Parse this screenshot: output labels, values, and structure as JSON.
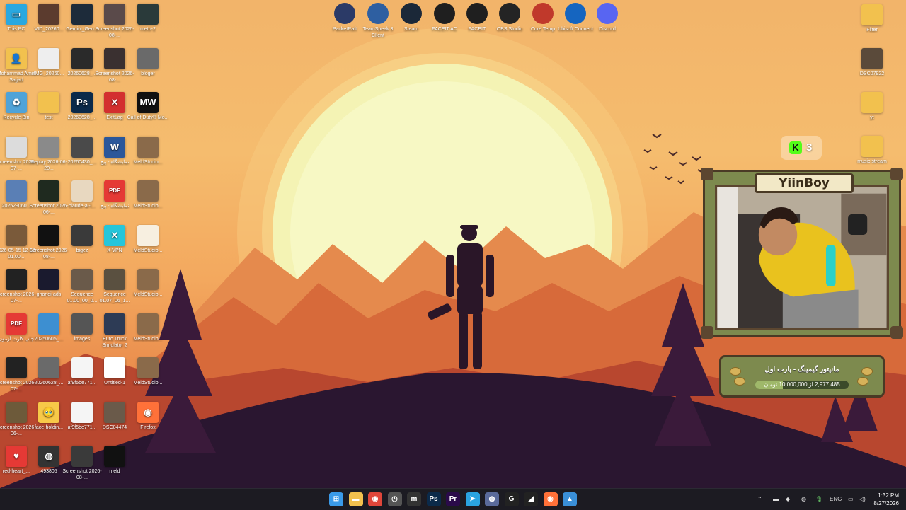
{
  "desktop": {
    "top_icons": [
      {
        "label": "PacketRaft",
        "icon": "packetraft-icon",
        "color": "#2b3a67"
      },
      {
        "label": "TeamSpeak 3 Client",
        "icon": "teamspeak-icon",
        "color": "#2e5fa1"
      },
      {
        "label": "Steam",
        "icon": "steam-icon",
        "color": "#1b2838"
      },
      {
        "label": "FACEIT AC",
        "icon": "faceit-ac-icon",
        "color": "#1f1f1f"
      },
      {
        "label": "FACEIT",
        "icon": "faceit-icon",
        "color": "#1f1f1f"
      },
      {
        "label": "OBS Studio",
        "icon": "obs-icon",
        "color": "#242424"
      },
      {
        "label": "Core Temp",
        "icon": "thermometer-icon",
        "color": "#c0392b"
      },
      {
        "label": "Ubisoft Connect",
        "icon": "ubisoft-icon",
        "color": "#1565c0"
      },
      {
        "label": "Discord",
        "icon": "discord-icon",
        "color": "#5865f2"
      }
    ],
    "columns": [
      [
        {
          "label": "This PC",
          "icon": "monitor-icon",
          "color": "#29a8e0",
          "glyph": "▭"
        },
        {
          "label": "Mohammad Amin Sajjad",
          "icon": "user-folder-icon",
          "color": "#f2c14e",
          "glyph": "👤"
        },
        {
          "label": "Recycle Bin",
          "icon": "recycle-bin-icon",
          "color": "#4fa3d8",
          "glyph": "♻"
        },
        {
          "label": "Screenshot 2026-07-...",
          "icon": "screenshot-icon",
          "color": "#dcdcdc",
          "glyph": ""
        },
        {
          "label": "202529060...",
          "icon": "photo-icon",
          "color": "#5a7fb5",
          "glyph": ""
        },
        {
          "label": "2026-05-15 12-17-01.00...",
          "icon": "video-icon",
          "color": "#7a5a3a",
          "glyph": ""
        },
        {
          "label": "Screenshot 2026-07-...",
          "icon": "screenshot-icon",
          "color": "#222",
          "glyph": ""
        },
        {
          "label": "چاپ کارت آزمون",
          "icon": "pdf-icon",
          "color": "#e53935",
          "glyph": "PDF"
        },
        {
          "label": "Screenshot 2026-07-...",
          "icon": "screenshot-icon",
          "color": "#222",
          "glyph": ""
        },
        {
          "label": "Screenshot 2026-06-...",
          "icon": "screenshot-icon",
          "color": "#6d5a3a",
          "glyph": ""
        },
        {
          "label": "red-heart_...",
          "icon": "heart-icon",
          "color": "#e53935",
          "glyph": "♥"
        }
      ],
      [
        {
          "label": "VID_20260...",
          "icon": "video-icon",
          "color": "#5b3b2e",
          "glyph": ""
        },
        {
          "label": "IMG_20260...",
          "icon": "image-icon",
          "color": "#eee",
          "glyph": ""
        },
        {
          "label": "test",
          "icon": "folder-icon",
          "color": "#f2c14e",
          "glyph": ""
        },
        {
          "label": "Replay 2026-06-20...",
          "icon": "video-icon",
          "color": "#8a8a8a",
          "glyph": ""
        },
        {
          "label": "Screenshot 2026-06-...",
          "icon": "screenshot-icon",
          "color": "#1f2a1f",
          "glyph": ""
        },
        {
          "label": "Screenshot 2026-08-...",
          "icon": "screenshot-icon",
          "color": "#111",
          "glyph": ""
        },
        {
          "label": "ghandi-ads",
          "icon": "video-icon",
          "color": "#1a1a2e",
          "glyph": ""
        },
        {
          "label": "20250605_...",
          "icon": "photo-icon",
          "color": "#3d8fd1",
          "glyph": ""
        },
        {
          "label": "20260628_...",
          "icon": "video-icon",
          "color": "#6a6a6a",
          "glyph": ""
        },
        {
          "label": "face-holdin...",
          "icon": "emoji-icon",
          "color": "#f7c948",
          "glyph": "🥹"
        },
        {
          "label": "493805",
          "icon": "globe-icon",
          "color": "#333",
          "glyph": "◍"
        }
      ],
      [
        {
          "label": "Gemini_Gen...",
          "icon": "image-icon",
          "color": "#1d2b3a",
          "glyph": ""
        },
        {
          "label": "20260628_...",
          "icon": "video-icon",
          "color": "#2a2a2a",
          "glyph": ""
        },
        {
          "label": "20260628_...",
          "icon": "psd-icon",
          "color": "#0b2a4a",
          "glyph": "Ps"
        },
        {
          "label": "20260430_...",
          "icon": "video-icon",
          "color": "#4a4a4a",
          "glyph": ""
        },
        {
          "label": "claude-ai-l...",
          "icon": "image-icon",
          "color": "#e8d8c0",
          "glyph": ""
        },
        {
          "label": "bigez",
          "icon": "video-icon",
          "color": "#3a3a3a",
          "glyph": ""
        },
        {
          "label": "Sequence 01.00_00_0...",
          "icon": "video-icon",
          "color": "#6a5a4a",
          "glyph": ""
        },
        {
          "label": "images",
          "icon": "image-icon",
          "color": "#555",
          "glyph": ""
        },
        {
          "label": "af9f5be771...",
          "icon": "image-icon",
          "color": "#f5f5f5",
          "glyph": ""
        },
        {
          "label": "af9f5be771...",
          "icon": "image-icon",
          "color": "#f5f5f5",
          "glyph": ""
        },
        {
          "label": "Screenshot 2026-08-...",
          "icon": "screenshot-icon",
          "color": "#3a3a3a",
          "glyph": ""
        }
      ],
      [
        {
          "label": "Screenshot 2026-08-...",
          "icon": "screenshot-icon",
          "color": "#5a4a4a",
          "glyph": ""
        },
        {
          "label": "Screenshot 2026-08-...",
          "icon": "screenshot-icon",
          "color": "#3a3030",
          "glyph": ""
        },
        {
          "label": "ExitLag",
          "icon": "exitlag-icon",
          "color": "#d32f2f",
          "glyph": "✕"
        },
        {
          "label": "نمایشگاه - پیج",
          "icon": "word-icon",
          "color": "#2b579a",
          "glyph": "W"
        },
        {
          "label": "نمایشگاه - پیج",
          "icon": "pdf-icon",
          "color": "#e53935",
          "glyph": "PDF"
        },
        {
          "label": "X-VPN",
          "icon": "xvpn-icon",
          "color": "#26c6da",
          "glyph": "✕"
        },
        {
          "label": "Sequence 01.07_06_1...",
          "icon": "video-icon",
          "color": "#5a5040",
          "glyph": ""
        },
        {
          "label": "Euro Truck Simulator 2",
          "icon": "truck-icon",
          "color": "#2d3b55",
          "glyph": ""
        },
        {
          "label": "Untitled-1",
          "icon": "image-icon",
          "color": "#ffffff",
          "glyph": ""
        },
        {
          "label": "DSC04474",
          "icon": "photo-icon",
          "color": "#6a5a4a",
          "glyph": ""
        },
        {
          "label": "meld",
          "icon": "video-icon",
          "color": "#111",
          "glyph": ""
        }
      ],
      [
        {
          "label": "meto-2",
          "icon": "screenshot-icon",
          "color": "#2a3a3a",
          "glyph": ""
        },
        {
          "label": "bloger",
          "icon": "video-icon",
          "color": "#6a6a6a",
          "glyph": ""
        },
        {
          "label": "Call of Duty® Mo...",
          "icon": "cod-icon",
          "color": "#111",
          "glyph": "MW"
        },
        {
          "label": "MeldStudio...",
          "icon": "video-icon",
          "color": "#8a6a4a",
          "glyph": ""
        },
        {
          "label": "MeldStudio...",
          "icon": "video-icon",
          "color": "#8a6a4a",
          "glyph": ""
        },
        {
          "label": "MeldStudio...",
          "icon": "file-icon",
          "color": "#f7efe0",
          "glyph": ""
        },
        {
          "label": "MeldStudio...",
          "icon": "video-icon",
          "color": "#8a6a4a",
          "glyph": ""
        },
        {
          "label": "MeldStudio...",
          "icon": "video-icon",
          "color": "#8a6a4a",
          "glyph": ""
        },
        {
          "label": "MeldStudio...",
          "icon": "video-icon",
          "color": "#8a6a4a",
          "glyph": ""
        },
        {
          "label": "Firefox",
          "icon": "firefox-icon",
          "color": "#ff7139",
          "glyph": "◉"
        }
      ]
    ],
    "right_icons": [
      {
        "label": "Filter",
        "icon": "folder-icon",
        "color": "#f2c14e"
      },
      {
        "label": "DSC07922",
        "icon": "photo-icon",
        "color": "#5a4a3a"
      },
      {
        "label": "yt",
        "icon": "folder-icon",
        "color": "#f2c14e"
      },
      {
        "label": "music stream",
        "icon": "folder-icon",
        "color": "#f2c14e"
      }
    ]
  },
  "overlay": {
    "kick_count": "3",
    "streamer_name": "YiinBoy",
    "goal_title": "مانیتور گیمینگ - پارت اول",
    "goal_text": "2,977,485 از 10,000,000 تومان",
    "goal_progress": 0.2977
  },
  "taskbar": {
    "apps": [
      {
        "icon": "windows-start-icon",
        "color": "#3a9ae8",
        "glyph": "⊞"
      },
      {
        "icon": "file-explorer-icon",
        "color": "#f2c14e",
        "glyph": "▬"
      },
      {
        "icon": "chrome-icon",
        "color": "#e0463a",
        "glyph": "◉"
      },
      {
        "icon": "clock-app-icon",
        "color": "#555",
        "glyph": "◷"
      },
      {
        "icon": "meld-icon",
        "color": "#333",
        "glyph": "m",
        "active": true
      },
      {
        "icon": "photoshop-icon",
        "color": "#0b2a4a",
        "glyph": "Ps"
      },
      {
        "icon": "premiere-icon",
        "color": "#2a0a4a",
        "glyph": "Pr"
      },
      {
        "icon": "telegram-icon",
        "color": "#2aa3df",
        "glyph": "➤"
      },
      {
        "icon": "app-icon",
        "color": "#5a6a9a",
        "glyph": "◍"
      },
      {
        "icon": "cursor-app-icon",
        "color": "#222",
        "glyph": "G"
      },
      {
        "icon": "faceit-icon",
        "color": "#222",
        "glyph": "◢"
      },
      {
        "icon": "firefox-icon",
        "color": "#ff7139",
        "glyph": "◉"
      },
      {
        "icon": "photos-icon",
        "color": "#3a8fd8",
        "glyph": "▲"
      }
    ],
    "language": "ENG",
    "time": "1:32 PM",
    "date": "8/27/2026"
  }
}
